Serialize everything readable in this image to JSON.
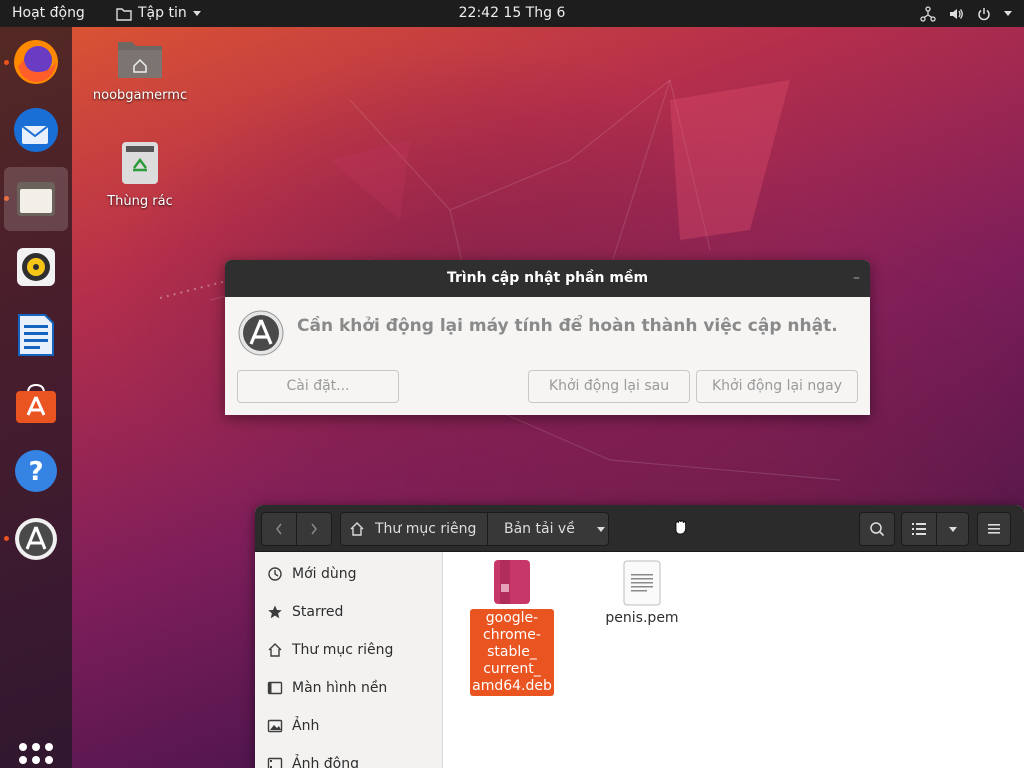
{
  "topbar": {
    "activities": "Hoạt động",
    "app_menu": "Tập tin",
    "clock": "22:42  15 Thg 6"
  },
  "dock": {
    "apps": [
      {
        "name": "Firefox",
        "icon": "firefox-icon",
        "running": true
      },
      {
        "name": "Thunderbird",
        "icon": "thunderbird-icon",
        "running": false
      },
      {
        "name": "Files",
        "icon": "files-icon",
        "running": true,
        "active": true
      },
      {
        "name": "Rhythmbox",
        "icon": "rhythmbox-icon",
        "running": false
      },
      {
        "name": "LibreOffice Writer",
        "icon": "writer-icon",
        "running": false
      },
      {
        "name": "Ubuntu Software",
        "icon": "software-icon",
        "running": false
      },
      {
        "name": "Help",
        "icon": "help-icon",
        "running": false
      },
      {
        "name": "Software Updater",
        "icon": "updater-icon",
        "running": true
      }
    ]
  },
  "desktop": {
    "home_label": "noobgamermc",
    "trash_label": "Thùng rác"
  },
  "dialog": {
    "title": "Trình cập nhật phần mềm",
    "minimize": "–",
    "message": "Cần khởi động lại máy tính để hoàn thành việc cập nhật.",
    "settings_button": "Cài đặt...",
    "later_button": "Khởi động lại sau",
    "now_button": "Khởi động lại ngay"
  },
  "files": {
    "path_home": "Thư mục riêng",
    "path_current": "Bản tải về",
    "sidebar": [
      {
        "label": "Mới dùng",
        "icon": "clock-icon"
      },
      {
        "label": "Starred",
        "icon": "star-icon"
      },
      {
        "label": "Thư mục riêng",
        "icon": "home-icon"
      },
      {
        "label": "Màn hình nền",
        "icon": "desktop-icon"
      },
      {
        "label": "Ảnh",
        "icon": "image-icon"
      },
      {
        "label": "Ảnh động",
        "icon": "video-icon"
      }
    ],
    "items": [
      {
        "name": "google-chrome-stable_current_amd64.deb",
        "lines": [
          "google-",
          "chrome-",
          "stable_",
          "current_",
          "amd64.deb"
        ],
        "selected": true
      },
      {
        "name": "penis.pem",
        "selected": false
      }
    ]
  },
  "colors": {
    "accent": "#e95420",
    "topbar": "#1d1d1d",
    "dialog_header": "#2f2f2f"
  }
}
